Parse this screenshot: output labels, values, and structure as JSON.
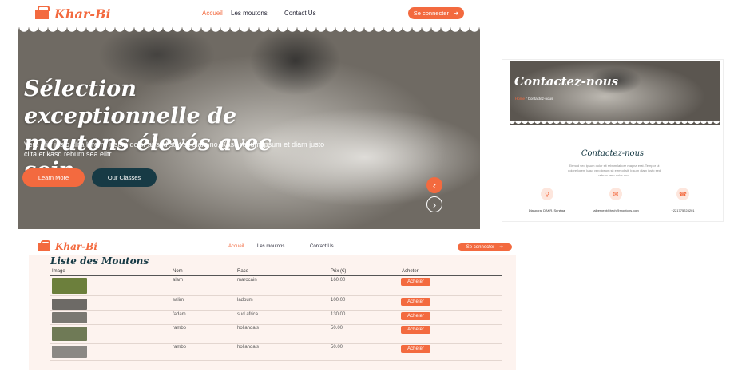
{
  "brand": {
    "name": "Khar-Bi",
    "color": "#f36a3f",
    "dark": "#173a45"
  },
  "nav": {
    "home": "Accueil",
    "sheep": "Les moutons",
    "contact": "Contact Us",
    "login": "Se connecter",
    "login_icon": "arrow-right-icon"
  },
  "hero": {
    "title": "Sélection exceptionnelle de moutons élevés avec soin.",
    "text": "Vero elitr justo clita lorem. Ipsum dolor at sed stet sit diam no. Kasd rebum ipsum et diam justo clita et kasd rebum sea elitr.",
    "btn_more": "Learn More",
    "btn_classes": "Our Classes",
    "prev": "‹",
    "next": "›"
  },
  "contact": {
    "hero_title": "Contactez-nous",
    "crumb_home": "Home",
    "crumb_current": "Contactez-nous",
    "title": "Contactez-nous",
    "text": "Eirmod sed ipsum dolor sit rebum labore magna erat. Tempor ut dolore lorem kasd vero ipsum sit eirmod sit. Ipsum diam justo sed rebum vero dolor duo.",
    "address": "Diaspora, DAKR, Sénégal",
    "email": "talbergent@tech@moutons.com",
    "phone": "+221775228201",
    "icons": [
      "location-pin-icon",
      "envelope-icon",
      "phone-icon"
    ]
  },
  "list": {
    "title": "Liste des Moutons",
    "columns": {
      "image": "Image",
      "name": "Nom",
      "race": "Race",
      "price": "Prix (€)",
      "buy": "Acheter"
    },
    "rows": [
      {
        "name": "alam",
        "race": "marocain",
        "price": "160.00",
        "action": "Acheter",
        "thumb_color": "#6c7f3c"
      },
      {
        "name": "salim",
        "race": "ladoum",
        "price": "100.00",
        "action": "Acheter",
        "thumb_color": "#6d6a66"
      },
      {
        "name": "fadam",
        "race": "sud africa",
        "price": "130.00",
        "action": "Acheter",
        "thumb_color": "#7a7872"
      },
      {
        "name": "rambo",
        "race": "hollandais",
        "price": "50.00",
        "action": "Acheter",
        "thumb_color": "#6f7a56"
      },
      {
        "name": "rambo",
        "race": "hollandais",
        "price": "50.00",
        "action": "Acheter",
        "thumb_color": "#8b8884"
      }
    ]
  }
}
